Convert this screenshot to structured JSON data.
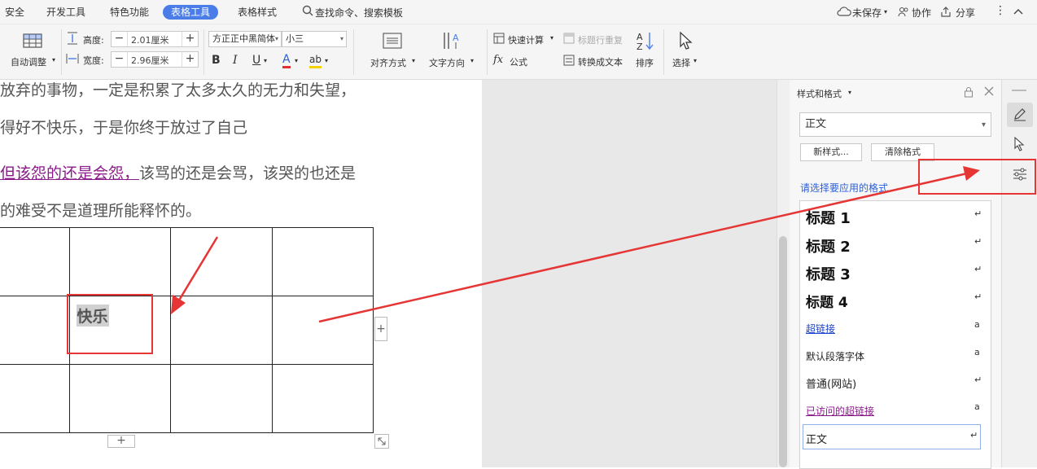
{
  "menubar": {
    "tabs": [
      "安全",
      "开发工具",
      "特色功能",
      "表格工具",
      "表格样式"
    ],
    "active_tab": "表格工具",
    "search_label": "查找命令、搜索模板",
    "unsaved_label": "未保存",
    "collab_label": "协作",
    "share_label": "分享"
  },
  "ribbon": {
    "autofit_label": "自动调整",
    "height_label": "高度:",
    "height_value": "2.01厘米",
    "width_label": "宽度:",
    "width_value": "2.96厘米",
    "font_name": "方正正中黑简体",
    "font_size": "小三",
    "bold": "B",
    "italic": "I",
    "underline": "U",
    "font_color": "A",
    "highlight": "ab",
    "align_label": "对齐方式",
    "text_dir_label": "文字方向",
    "quick_calc_label": "快速计算",
    "repeat_header_label": "标题行重复",
    "formula_label": "公式",
    "convert_text_label": "转换成文本",
    "sort_label": "排序",
    "select_label": "选择"
  },
  "document": {
    "lines": [
      "放弃的事物，一定是积累了太多太久的无力和失望，",
      "得好不快乐，于是你终于放过了自己",
      "该骂的还是会骂，该哭的也还是",
      "的难受不是道理所能释怀的。"
    ],
    "link_text": "但该怨的还是会怨，",
    "table_word": "快乐",
    "add_symbol": "+"
  },
  "panel": {
    "title": "样式和格式",
    "current_style": "正文",
    "new_style_label": "新样式...",
    "clear_format_label": "清除格式",
    "apply_prompt": "请选择要应用的格式",
    "styles": [
      {
        "name": "标题  1",
        "mark": "↵"
      },
      {
        "name": "标题  2",
        "mark": "↵"
      },
      {
        "name": "标题  3",
        "mark": "↵"
      },
      {
        "name": "标题  4",
        "mark": "↵"
      },
      {
        "name": "超链接",
        "mark": "a"
      },
      {
        "name": "默认段落字体",
        "mark": "a"
      },
      {
        "name": "普通(网站)",
        "mark": "↵"
      },
      {
        "name": "已访问的超链接",
        "mark": "a"
      },
      {
        "name": "正文",
        "mark": "↵"
      }
    ]
  },
  "colors": {
    "accent": "#4a7de8",
    "annotation_red": "#e53535",
    "link_purple": "#8a1a8a"
  }
}
